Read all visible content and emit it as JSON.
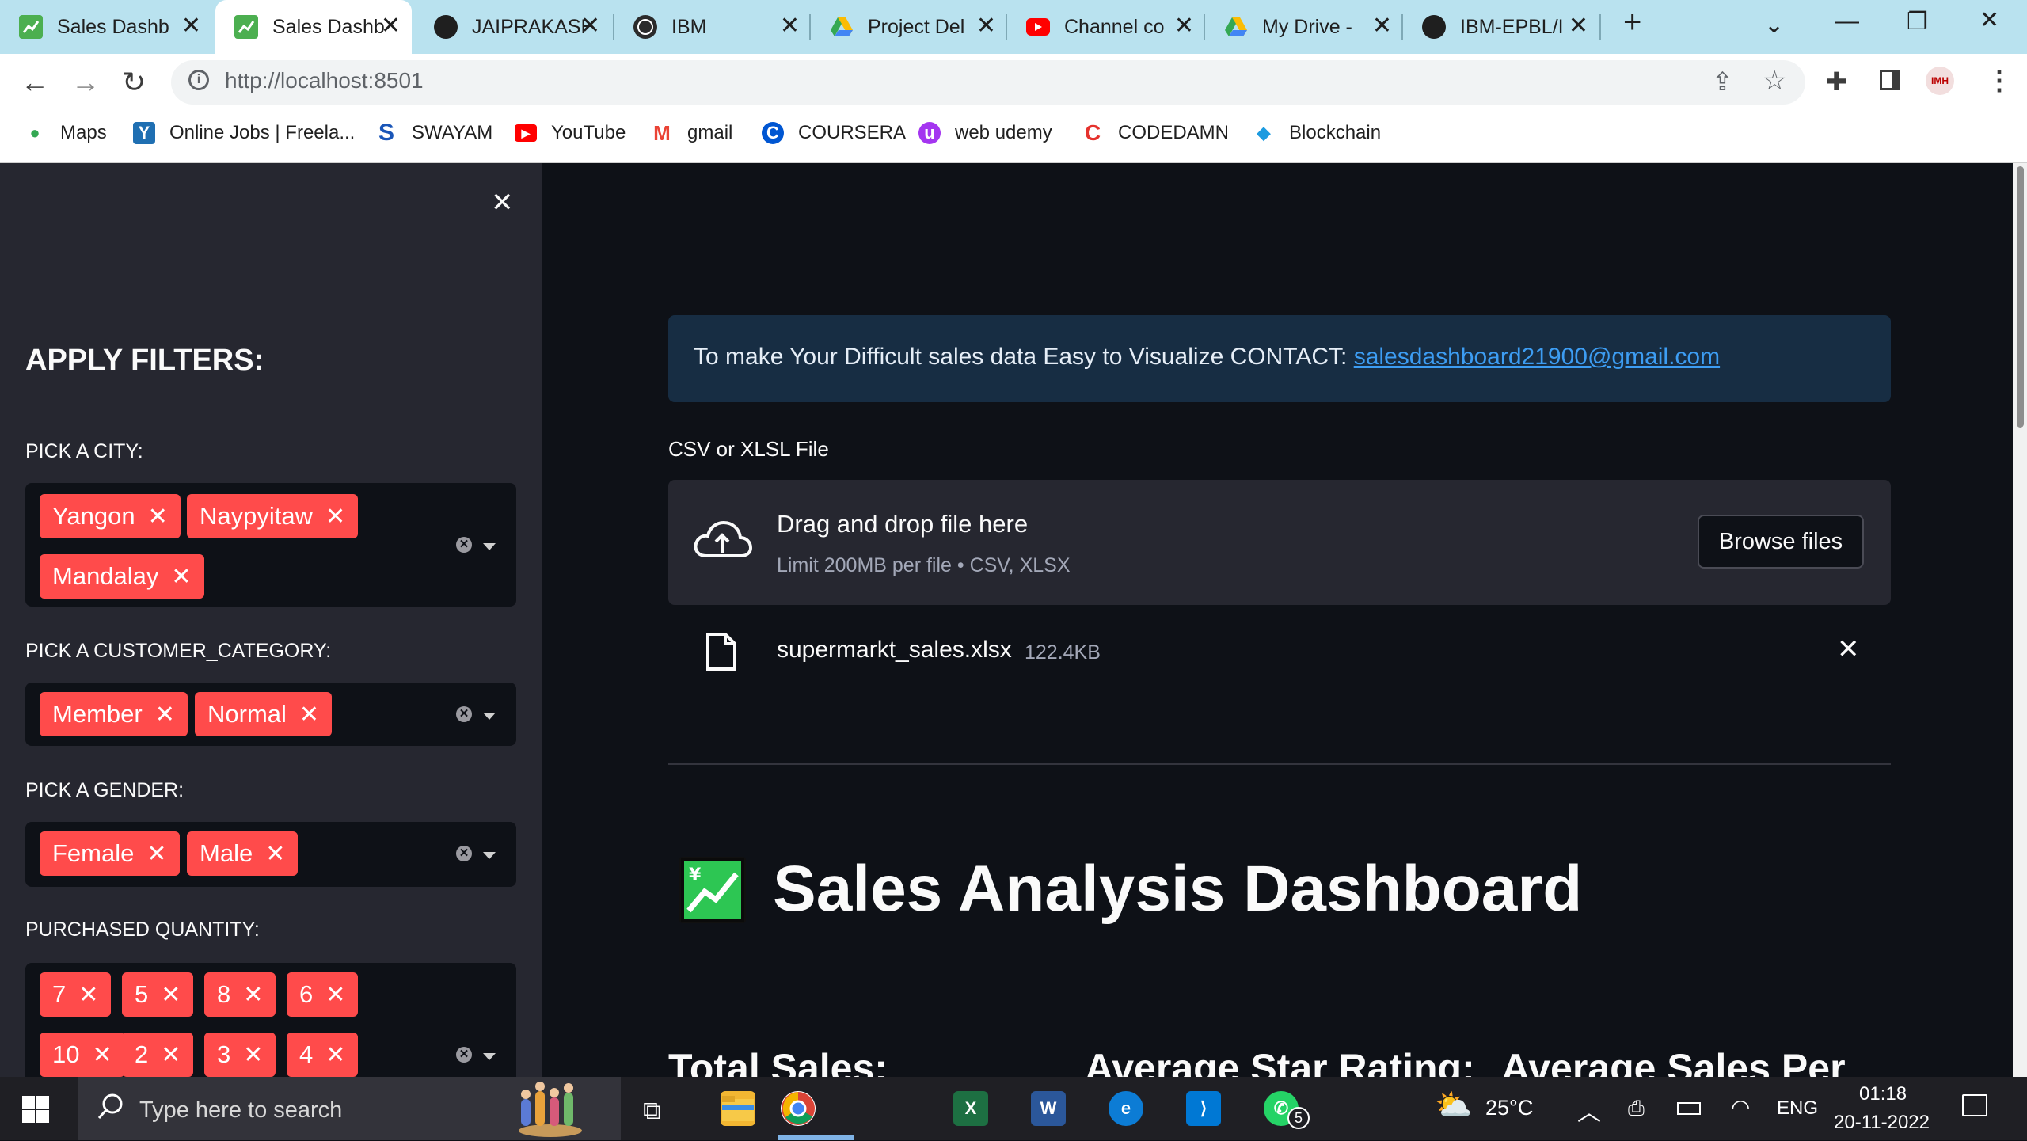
{
  "browser": {
    "tabs": [
      {
        "title": "Sales Dashb",
        "active": false,
        "favicon": "streamlit-chart-icon"
      },
      {
        "title": "Sales Dashb",
        "active": true,
        "favicon": "streamlit-chart-icon"
      },
      {
        "title": "JAIPRAKASH",
        "active": false,
        "favicon": "github-icon"
      },
      {
        "title": "IBM",
        "active": false,
        "favicon": "globe-icon"
      },
      {
        "title": "Project Del",
        "active": false,
        "favicon": "google-drive-icon"
      },
      {
        "title": "Channel co",
        "active": false,
        "favicon": "youtube-icon"
      },
      {
        "title": "My Drive -",
        "active": false,
        "favicon": "google-drive-icon"
      },
      {
        "title": "IBM-EPBL/I",
        "active": false,
        "favicon": "github-icon"
      }
    ],
    "new_tab": "+",
    "url": "http://localhost:8501",
    "profile_badge": "IMH",
    "bookmarks": [
      {
        "label": "Maps",
        "icon": "maps-icon",
        "color": "#34a853"
      },
      {
        "label": "Online Jobs | Freela...",
        "icon": "freelancer-icon",
        "color": "#1f6fb2"
      },
      {
        "label": "SWAYAM",
        "icon": "swayam-icon",
        "color": "#1a56b8"
      },
      {
        "label": "YouTube",
        "icon": "youtube-icon",
        "color": "#ff0000"
      },
      {
        "label": "gmail",
        "icon": "gmail-icon",
        "color": "#ea4335"
      },
      {
        "label": "COURSERA",
        "icon": "coursera-icon",
        "color": "#0056d2"
      },
      {
        "label": "web udemy",
        "icon": "udemy-icon",
        "color": "#a435f0"
      },
      {
        "label": "CODEDAMN",
        "icon": "codedamn-icon",
        "color": "#e5322d"
      },
      {
        "label": "Blockchain",
        "icon": "blockchain-icon",
        "color": "#1c9be0"
      }
    ]
  },
  "sidebar": {
    "close": "✕",
    "heading": "APPLY FILTERS:",
    "city": {
      "label": "PICK A CITY:",
      "chips": [
        "Yangon",
        "Naypyitaw",
        "Mandalay"
      ]
    },
    "customer": {
      "label": "PICK A CUSTOMER_CATEGORY:",
      "chips": [
        "Member",
        "Normal"
      ]
    },
    "gender": {
      "label": "PICK A GENDER:",
      "chips": [
        "Female",
        "Male"
      ]
    },
    "quantity": {
      "label": "PURCHASED QUANTITY:",
      "chips": [
        "7",
        "5",
        "8",
        "6",
        "10",
        "2",
        "3",
        "4"
      ]
    }
  },
  "main": {
    "info_text": "To make Your Difficult sales data Easy to Visualize CONTACT: ",
    "info_email": "salesdashboard21900@gmail.com",
    "uploader_label": "CSV or XLSL File",
    "drop_title": "Drag and drop file here",
    "drop_limit": "Limit 200MB per file • CSV, XLSX",
    "browse_label": "Browse files",
    "file_name": "supermarkt_sales.xlsx",
    "file_size": "122.4KB",
    "title": "Sales Analysis Dashboard",
    "metrics": [
      "Total Sales:",
      "Average Star Rating:",
      "Average Sales Per"
    ]
  },
  "taskbar": {
    "search_placeholder": "Type here to search",
    "whatsapp_badge": "5",
    "weather": "25°C",
    "language": "ENG",
    "time": "01:18",
    "date": "20-11-2022"
  },
  "colors": {
    "accent": "#ff4b4b",
    "info_bg": "#172d43",
    "link": "#3d9df3",
    "tabstrip": "#b9e2ef"
  }
}
